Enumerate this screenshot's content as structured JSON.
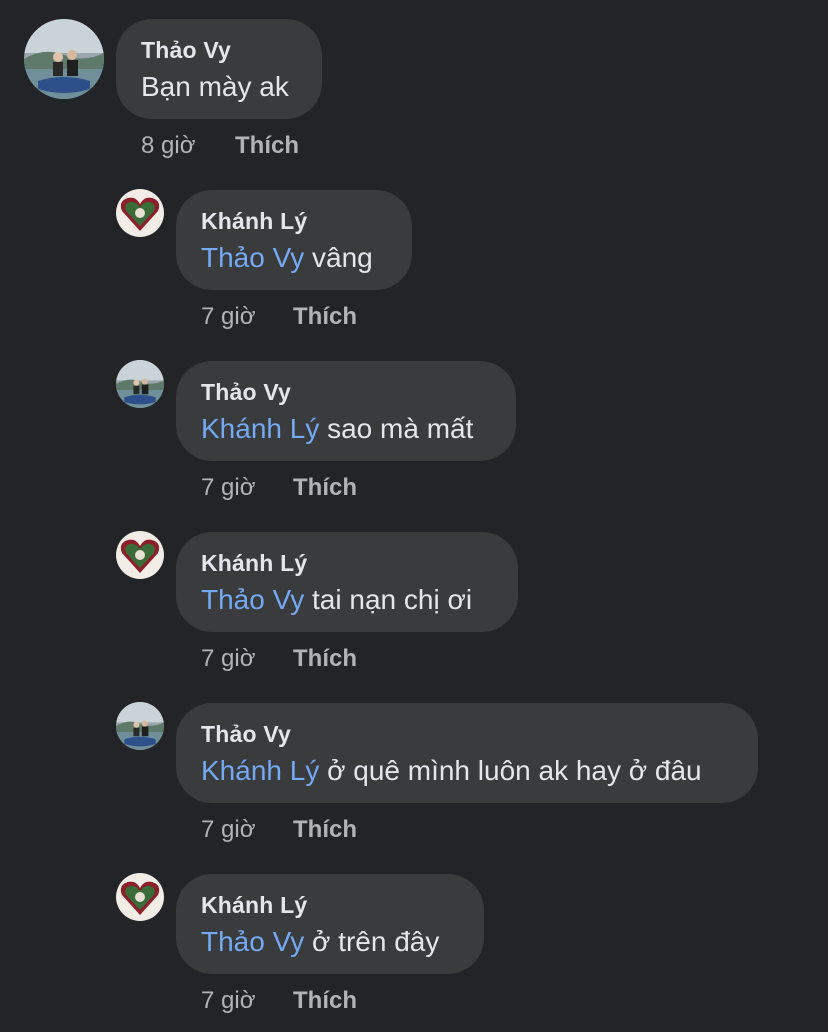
{
  "comments": [
    {
      "author": "Thảo Vy",
      "mention": "",
      "text": "Bạn mày ak",
      "time": "8 giờ",
      "like_label": "Thích",
      "avatar": "thao-vy-avatar"
    },
    {
      "author": "Khánh Lý",
      "mention": "Thảo Vy",
      "text": "vâng",
      "time": "7 giờ",
      "like_label": "Thích",
      "avatar": "khanh-ly-avatar"
    },
    {
      "author": "Thảo Vy",
      "mention": "Khánh Lý",
      "text": "sao mà mất",
      "time": "7 giờ",
      "like_label": "Thích",
      "avatar": "thao-vy-avatar"
    },
    {
      "author": "Khánh Lý",
      "mention": "Thảo Vy",
      "text": "tai nạn chị ơi",
      "time": "7 giờ",
      "like_label": "Thích",
      "avatar": "khanh-ly-avatar"
    },
    {
      "author": "Thảo Vy",
      "mention": "Khánh Lý",
      "text": "ở quê mình luôn ak hay ở đâu",
      "time": "7 giờ",
      "like_label": "Thích",
      "avatar": "thao-vy-avatar"
    },
    {
      "author": "Khánh Lý",
      "mention": "Thảo Vy",
      "text": "ở trên đây",
      "time": "7 giờ",
      "like_label": "Thích",
      "avatar": "khanh-ly-avatar"
    }
  ],
  "colors": {
    "background": "#232427",
    "bubble": "#3a3b3c",
    "mention": "#74a9f3",
    "text": "#e4e6eb",
    "meta": "#b0b3b8"
  }
}
